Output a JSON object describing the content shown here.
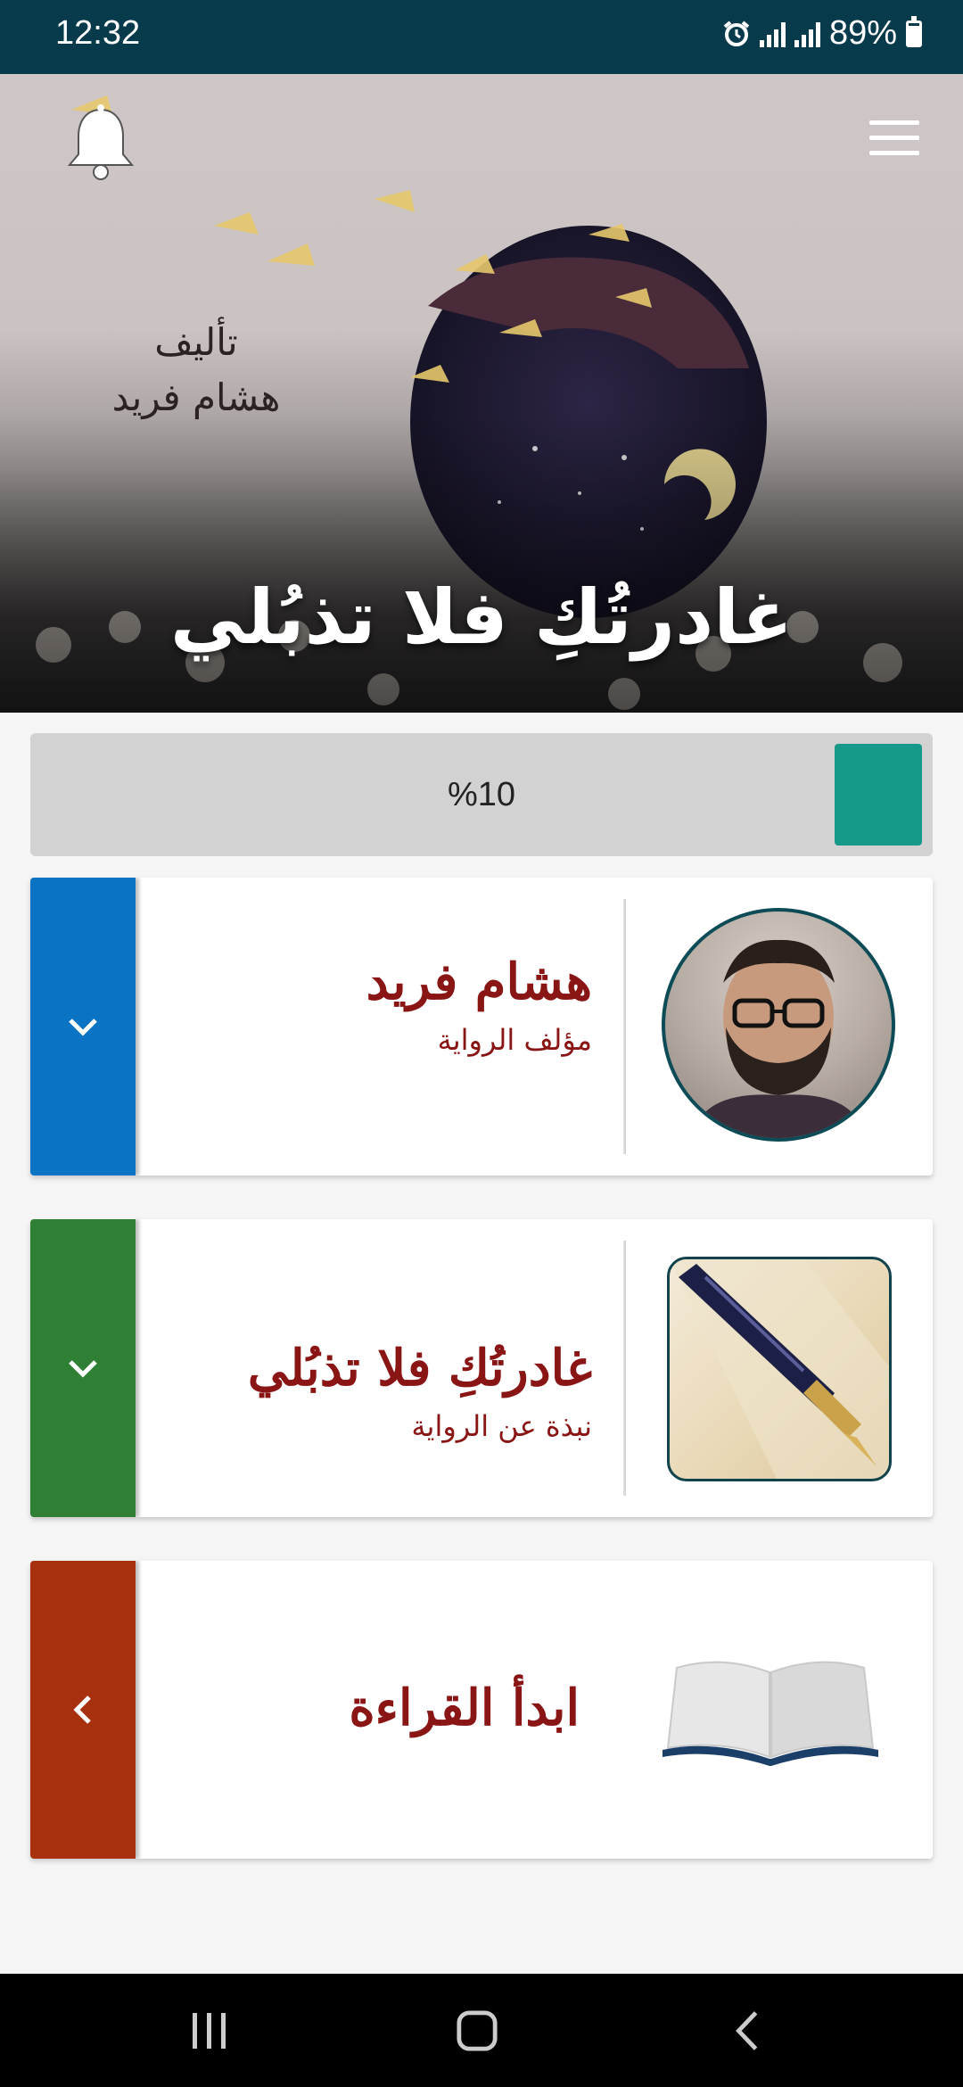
{
  "status_bar": {
    "time": "12:32",
    "battery": "89%"
  },
  "hero": {
    "author_label": "تأليف",
    "author_name": "هشام فريد",
    "title": "غادرتُكِ فلا تذبُلي"
  },
  "progress": {
    "label": "%10",
    "value_percent": 10,
    "color": "#17998a"
  },
  "cards": {
    "author": {
      "title": "هشام فريد",
      "subtitle": "مؤلف الرواية",
      "side_color": "#0b73c4",
      "icon": "chevron-down-icon"
    },
    "about": {
      "title": "غادرتُكِ فلا تذبُلي",
      "subtitle": "نبذة عن الرواية",
      "side_color": "#2f7f34",
      "icon": "chevron-down-icon"
    },
    "read": {
      "title": "ابدأ القراءة",
      "side_color": "#a7310f",
      "icon": "chevron-left-icon"
    }
  },
  "nav_bar": {
    "icons": [
      "recents-icon",
      "home-icon",
      "back-icon"
    ]
  }
}
